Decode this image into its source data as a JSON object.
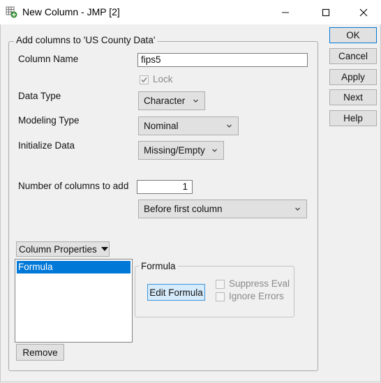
{
  "window": {
    "title": "New Column - JMP [2]",
    "minimize_icon": "minimize-icon",
    "maximize_icon": "maximize-icon",
    "close_icon": "close-icon"
  },
  "group_title": "Add columns to 'US County Data'",
  "column_name": {
    "label": "Column Name",
    "value": "fips5"
  },
  "lock": {
    "label": "Lock",
    "checked": true
  },
  "data_type": {
    "label": "Data Type",
    "value": "Character"
  },
  "modeling_type": {
    "label": "Modeling Type",
    "value": "Nominal"
  },
  "initialize_data": {
    "label": "Initialize Data",
    "value": "Missing/Empty"
  },
  "num_columns": {
    "label": "Number of columns to add",
    "value": "1"
  },
  "position": {
    "value": "Before first column"
  },
  "column_properties": {
    "menu_label": "Column Properties",
    "items": [
      "Formula"
    ],
    "remove_label": "Remove"
  },
  "formula_panel": {
    "title": "Formula",
    "edit_label": "Edit Formula",
    "suppress_eval": "Suppress Eval",
    "ignore_errors": "Ignore Errors"
  },
  "side_buttons": {
    "ok": "OK",
    "cancel": "Cancel",
    "apply": "Apply",
    "next": "Next",
    "help": "Help"
  },
  "colors": {
    "accent": "#0078d7",
    "background": "#f0f0f0"
  }
}
